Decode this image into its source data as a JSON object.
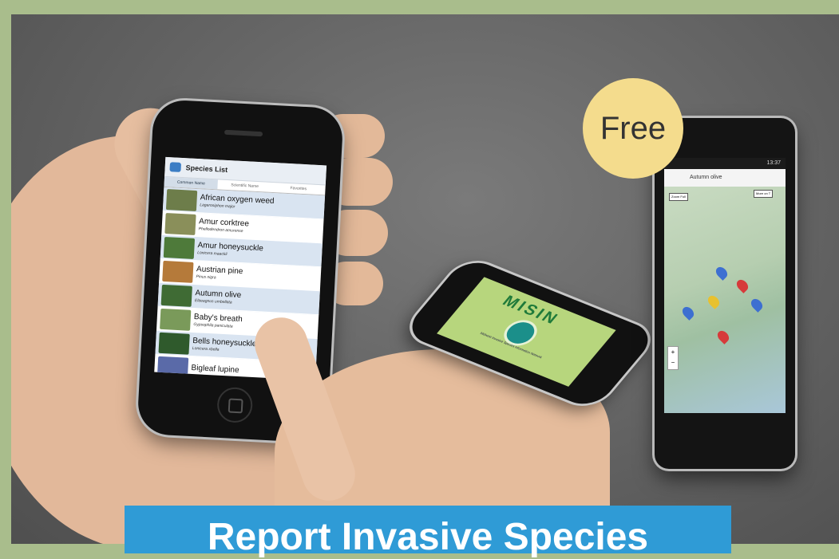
{
  "badge": {
    "text": "Free"
  },
  "banner": {
    "text": "Report Invasive Species"
  },
  "phone_left": {
    "title": "Species List",
    "tabs": [
      "Common Name",
      "Scientific Name",
      "Favorites"
    ],
    "species": [
      {
        "name": "African oxygen weed",
        "sci": "Lagarosiphon major"
      },
      {
        "name": "Amur corktree",
        "sci": "Phellodendron amurense"
      },
      {
        "name": "Amur honeysuckle",
        "sci": "Lonicera maackii"
      },
      {
        "name": "Austrian pine",
        "sci": "Pinus nigra"
      },
      {
        "name": "Autumn olive",
        "sci": "Elaeagnus umbellata"
      },
      {
        "name": "Baby's breath",
        "sci": "Gypsophila paniculata"
      },
      {
        "name": "Bells honeysuckle",
        "sci": "Lonicera xbella"
      },
      {
        "name": "Bigleaf lupine",
        "sci": ""
      }
    ]
  },
  "phone_middle": {
    "logo_text": "MISIN",
    "caption": "Midwest Invasive Species Information Network"
  },
  "phone_right": {
    "status_time": "13:37",
    "title": "Autumn olive",
    "map_btn_left": "Zoom Full",
    "map_btn_right": "More on T",
    "zoom_in": "+",
    "zoom_out": "−"
  },
  "colors": {
    "banner": "#2f9bd6",
    "badge": "#f4dc8d",
    "frame": "#a9bd8c"
  }
}
